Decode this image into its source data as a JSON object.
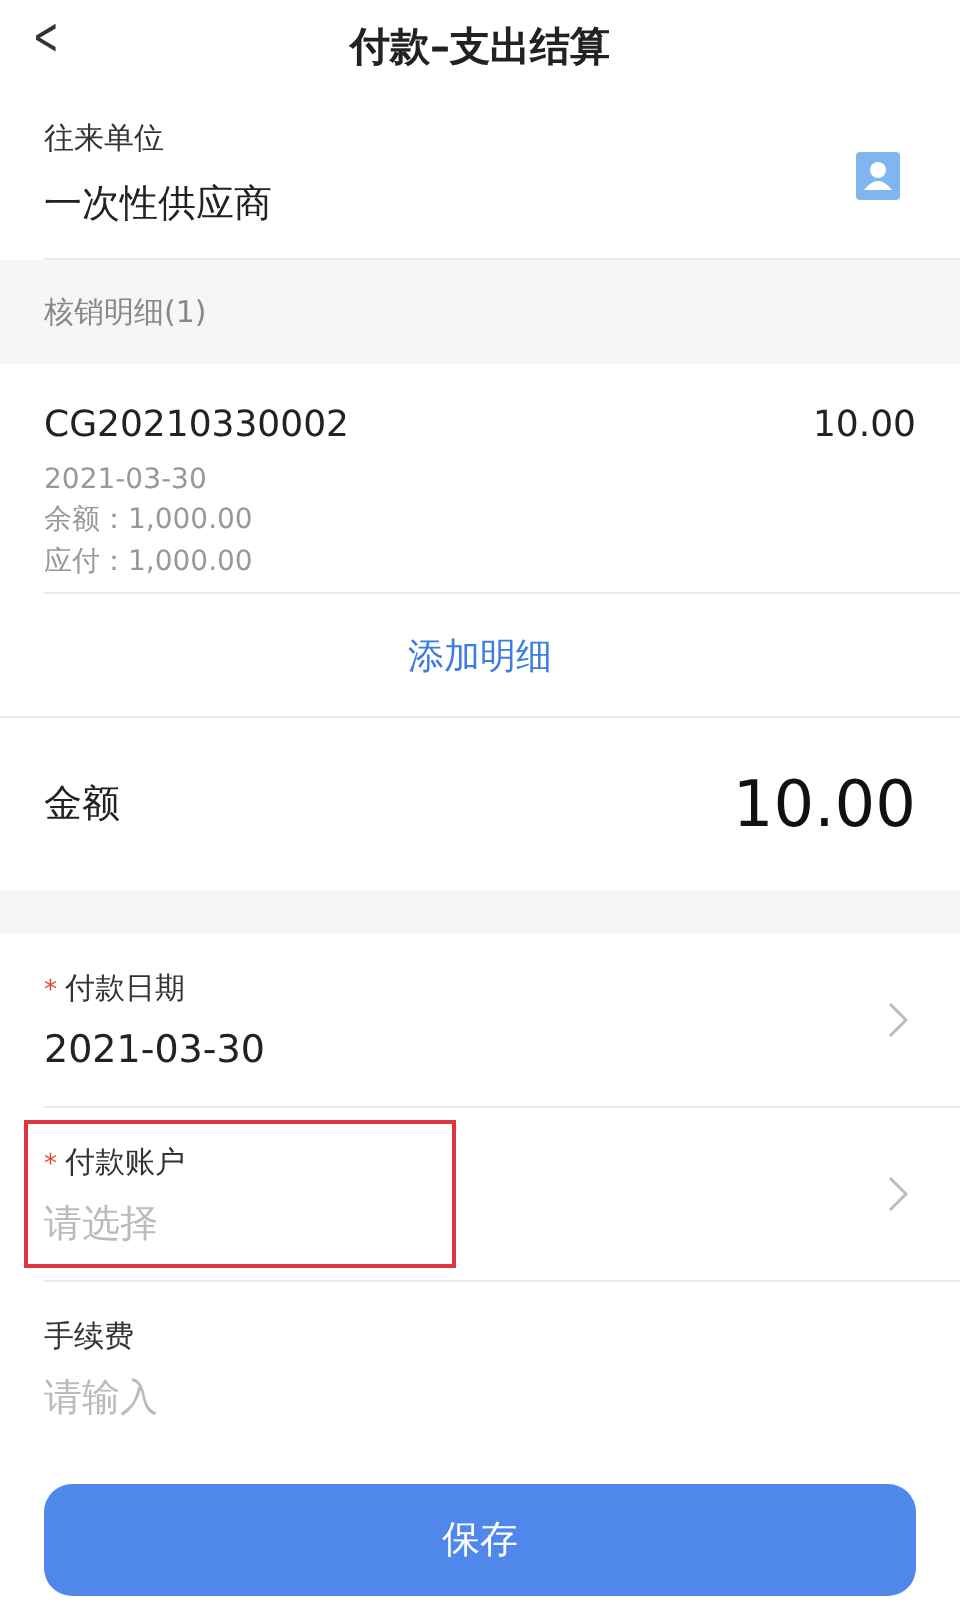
{
  "header": {
    "back": "<",
    "title": "付款–支出结算"
  },
  "party": {
    "label": "往来单位",
    "value": "一次性供应商"
  },
  "details": {
    "heading": "核销明细(1)",
    "items": [
      {
        "code": "CG20210330002",
        "amount": "10.00",
        "date": "2021-03-30",
        "balance": "余额：1,000.00",
        "payable": "应付：1,000.00"
      }
    ],
    "add_link": "添加明细"
  },
  "total": {
    "label": "金额",
    "value": "10.00"
  },
  "fields": [
    {
      "label": "付款日期",
      "marker": "*",
      "value": "2021-03-30",
      "chevron": true,
      "highlighted": false
    },
    {
      "label": "付款账户",
      "marker": "*",
      "placeholder": "请选择",
      "chevron": true,
      "highlighted": true
    },
    {
      "label": "手续费",
      "placeholder": "请输入",
      "chevron": false,
      "highlighted": false
    }
  ],
  "save_button": "保存"
}
